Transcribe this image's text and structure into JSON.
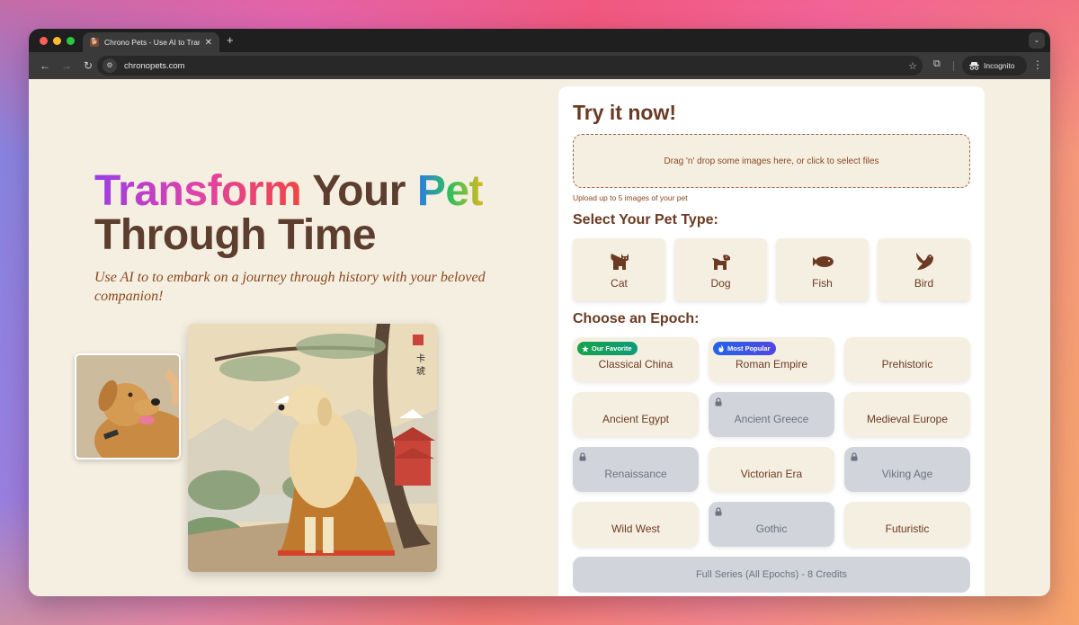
{
  "browser": {
    "tab_title": "Chrono Pets - Use AI to Trans",
    "tab_favicon": "dog-favicon",
    "url": "chronopets.com",
    "incognito_label": "Incognito"
  },
  "hero": {
    "title_part1": "Transform",
    "title_part2": " Your ",
    "title_part3": "Pet",
    "title_line2": "Through Time",
    "subtitle": "Use AI to to embark on a journey through history with your beloved companion!",
    "before_image_alt": "Golden retriever photo",
    "after_image_alt": "Golden retriever in Classical China painting style"
  },
  "panel": {
    "title": "Try it now!",
    "dropzone_text": "Drag 'n' drop some images here, or click to select files",
    "upload_hint": "Upload up to 5 images of your pet",
    "pet_type_heading": "Select Your Pet Type:",
    "pets": [
      {
        "label": "Cat",
        "icon": "cat-icon"
      },
      {
        "label": "Dog",
        "icon": "dog-icon"
      },
      {
        "label": "Fish",
        "icon": "fish-icon"
      },
      {
        "label": "Bird",
        "icon": "bird-icon"
      }
    ],
    "epoch_heading": "Choose an Epoch:",
    "epochs": [
      {
        "label": "Classical China",
        "locked": false,
        "badge": "Our Favorite"
      },
      {
        "label": "Roman Empire",
        "locked": false,
        "badge": "Most Popular"
      },
      {
        "label": "Prehistoric",
        "locked": false
      },
      {
        "label": "Ancient Egypt",
        "locked": false
      },
      {
        "label": "Ancient Greece",
        "locked": true
      },
      {
        "label": "Medieval Europe",
        "locked": false
      },
      {
        "label": "Renaissance",
        "locked": true
      },
      {
        "label": "Victorian Era",
        "locked": false
      },
      {
        "label": "Viking Age",
        "locked": true
      },
      {
        "label": "Wild West",
        "locked": false
      },
      {
        "label": "Gothic",
        "locked": true
      },
      {
        "label": "Futuristic",
        "locked": false
      }
    ],
    "full_series_label": "Full Series (All Epochs) - 8 Credits"
  },
  "colors": {
    "brand_brown": "#6b3a22",
    "cream": "#f5efe1",
    "locked_gray": "#d1d5db",
    "favorite_green": "#16a34a",
    "popular_blue": "#2563eb"
  }
}
